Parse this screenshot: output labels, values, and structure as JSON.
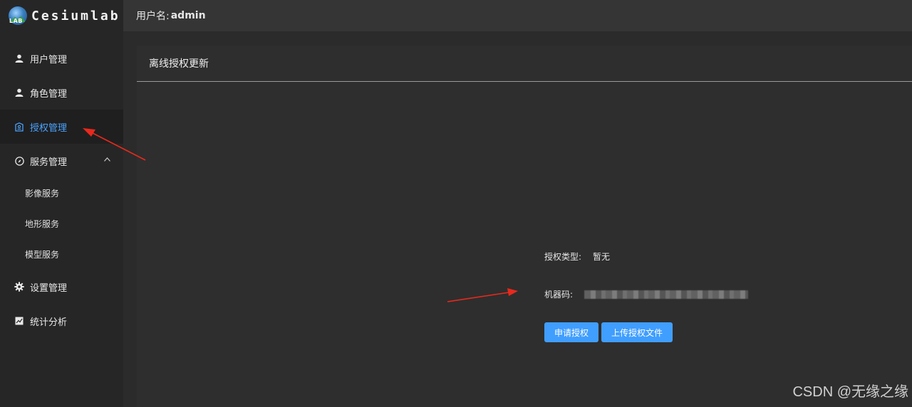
{
  "app": {
    "logo_text": "Cesiumlab",
    "logo_lab": "LAB"
  },
  "header": {
    "user_label": "用户名:",
    "username": "admin"
  },
  "sidebar": {
    "items": [
      {
        "label": "用户管理",
        "icon": "user-icon"
      },
      {
        "label": "角色管理",
        "icon": "user-icon"
      },
      {
        "label": "授权管理",
        "icon": "badge-icon",
        "active": true
      },
      {
        "label": "服务管理",
        "icon": "compass-icon",
        "expanded": true
      },
      {
        "label": "设置管理",
        "icon": "gear-icon"
      },
      {
        "label": "统计分析",
        "icon": "chart-icon"
      }
    ],
    "submenu": [
      {
        "label": "影像服务"
      },
      {
        "label": "地形服务"
      },
      {
        "label": "模型服务"
      }
    ]
  },
  "panel": {
    "title": "离线授权更新",
    "auth_type_label": "授权类型:",
    "auth_type_value": "暂无",
    "machine_code_label": "机器码:",
    "apply_button": "申请授权",
    "upload_button": "上传授权文件"
  },
  "watermark": "CSDN @无缘之缘",
  "colors": {
    "accent": "#409eff",
    "active_text": "#4aa3ff",
    "annotation_arrow": "#e8291c"
  }
}
